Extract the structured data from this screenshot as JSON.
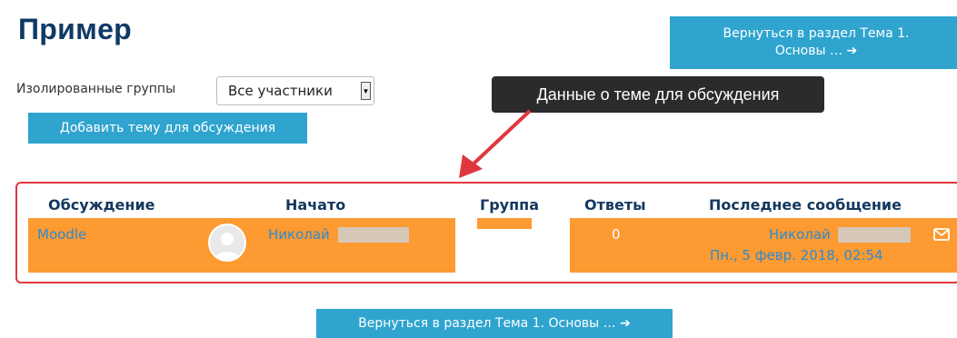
{
  "page_title": "Пример",
  "return_button_top": {
    "line1": "Вернуться в раздел Тема 1.",
    "line2": "Основы … ➔"
  },
  "groups": {
    "label": "Изолированные группы",
    "selected": "Все участники"
  },
  "add_topic_label": "Добавить тему для обсуждения",
  "annotation": "Данные о теме для обсуждения",
  "table": {
    "headers": {
      "discussion": "Обсуждение",
      "started_by": "Начато",
      "group": "Группа",
      "replies": "Ответы",
      "last_post": "Последнее сообщение"
    },
    "row": {
      "discussion": "Moodle",
      "started_by": "Николай",
      "group": "",
      "replies": "0",
      "last_post_author": "Николай",
      "last_post_date": "Пн., 5 февр. 2018, 02:54"
    }
  },
  "return_button_bottom": "Вернуться в раздел Тема 1. Основы … ➔",
  "colors": {
    "accent": "#2fa4cf",
    "row_highlight": "#fd9a31",
    "frame": "#e0373f",
    "title": "#0f3a66"
  },
  "icons": [
    "avatar-icon",
    "mail-icon",
    "arrow-icon",
    "dropdown-arrow-icon"
  ]
}
